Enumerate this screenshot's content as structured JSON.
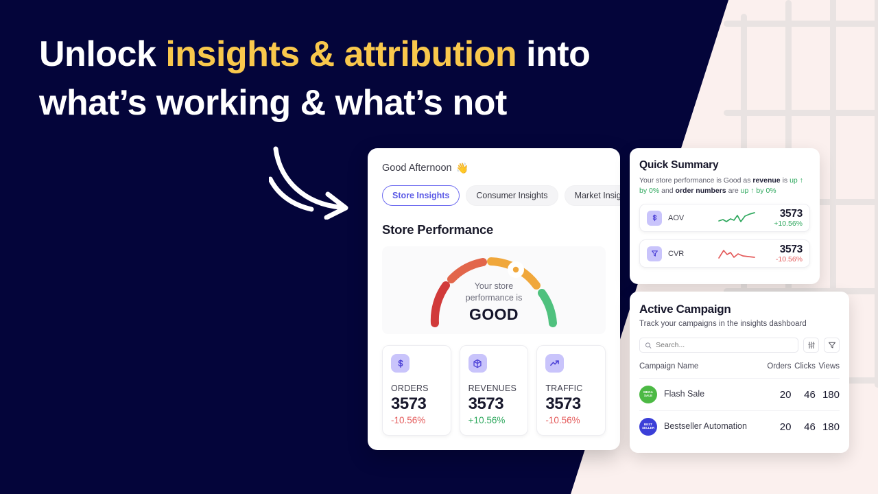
{
  "headline": {
    "line1_pre": "Unlock ",
    "line1_hl": "insights & attribution",
    "line1_post": " into",
    "line2": "what’s working & what’s not"
  },
  "colors": {
    "navy": "#04053A",
    "pink": "#FBF0EE",
    "accent_yellow": "#F9C84C",
    "purple": "#6F6DF0",
    "green": "#2FA85E",
    "red": "#E45B5B"
  },
  "dashboard": {
    "greeting": "Good Afternoon",
    "greeting_emoji": "👋",
    "tabs": [
      {
        "label": "Store Insights",
        "active": true
      },
      {
        "label": "Consumer Insights",
        "active": false
      },
      {
        "label": "Market Insights",
        "active": false
      }
    ],
    "section_title": "Store Performance",
    "gauge": {
      "caption_line1": "Your store",
      "caption_line2": "performance is",
      "verdict": "GOOD",
      "segments": [
        "#D13A3A",
        "#E2664B",
        "#F0A73B",
        "#4FC17E"
      ]
    },
    "tiles": [
      {
        "icon": "dollar-icon",
        "glyph": "$",
        "label": "ORDERS",
        "value": "3573",
        "delta": "-10.56%",
        "direction": "down"
      },
      {
        "icon": "box-icon",
        "glyph": "⬡",
        "label": "REVENUES",
        "value": "3573",
        "delta": "+10.56%",
        "direction": "up"
      },
      {
        "icon": "trending-up-icon",
        "glyph": "↗",
        "label": "TRAFFIC",
        "value": "3573",
        "delta": "-10.56%",
        "direction": "down"
      }
    ]
  },
  "quick_summary": {
    "title": "Quick Summary",
    "summary_parts": {
      "p1": "Your store performance is Good as ",
      "b1": "revenue",
      "p2": " is ",
      "g1": "up ↑ by 0%",
      "p3": " and ",
      "b2": "order numbers",
      "p4": " are ",
      "g2": "up ↑ by 0%"
    },
    "metrics": [
      {
        "icon": "dollar-icon",
        "glyph": "$",
        "label": "AOV",
        "value": "3573",
        "delta": "+10.56%",
        "direction": "up"
      },
      {
        "icon": "funnel-icon",
        "glyph": "▽",
        "label": "CVR",
        "value": "3573",
        "delta": "-10.56%",
        "direction": "down"
      }
    ]
  },
  "active_campaign": {
    "title": "Active Campaign",
    "subtitle": "Track your campaigns in the insights dashboard",
    "search": {
      "placeholder": "Search...",
      "value": ""
    },
    "buttons": [
      {
        "name": "settings-sliders-icon"
      },
      {
        "name": "filter-icon"
      }
    ],
    "table": {
      "headers": [
        "Campaign Name",
        "Orders",
        "Clicks",
        "Views"
      ],
      "rows": [
        {
          "badge_text": "MEGA\nSALE",
          "badge_color": "#4CB944",
          "name": "Flash Sale",
          "orders": "20",
          "clicks": "46",
          "views": "180"
        },
        {
          "badge_text": "BEST\nSELLER",
          "badge_color": "#3B3FD8",
          "name": "Bestseller Automation",
          "orders": "20",
          "clicks": "46",
          "views": "180"
        }
      ]
    }
  }
}
